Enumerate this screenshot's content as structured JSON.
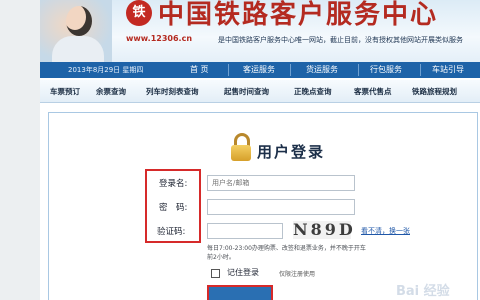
{
  "banner": {
    "title": "中国铁路客户服务中心",
    "url": "www.12306.cn",
    "note": "是中国铁路客户服务中心唯一网站，截止目前，没有授权其他网站开展类似服务",
    "logo_text": "铁"
  },
  "nav": {
    "date": "2013年8月29日 星期四",
    "items": [
      "首 页",
      "客运服务",
      "货运服务",
      "行包服务",
      "车站引导"
    ]
  },
  "subnav": {
    "items": [
      "车票预订",
      "余票查询",
      "列车时刻表查询",
      "起售时间查询",
      "正晚点查询",
      "客票代售点",
      "铁路旅程规划"
    ]
  },
  "login": {
    "title": "用户登录",
    "username_label": "登录名:",
    "username_placeholder": "用户名/邮箱",
    "password_label": "密　码:",
    "captcha_label": "验证码:",
    "captcha_text": "N89D",
    "captcha_link": "看不清，换一张",
    "hint": "每日7:00-23:00办理购票、改签和退票业务，并不晚于开车前2小时。",
    "remember_label": "记住登录",
    "remember_note": "仅限注册使用"
  },
  "watermark": "Bai 经验",
  "colors": {
    "nav_bg": "#1e63a8",
    "title_red": "#b42a20",
    "highlight_red": "#d62a2a",
    "button_blue": "#2a6fb2"
  }
}
